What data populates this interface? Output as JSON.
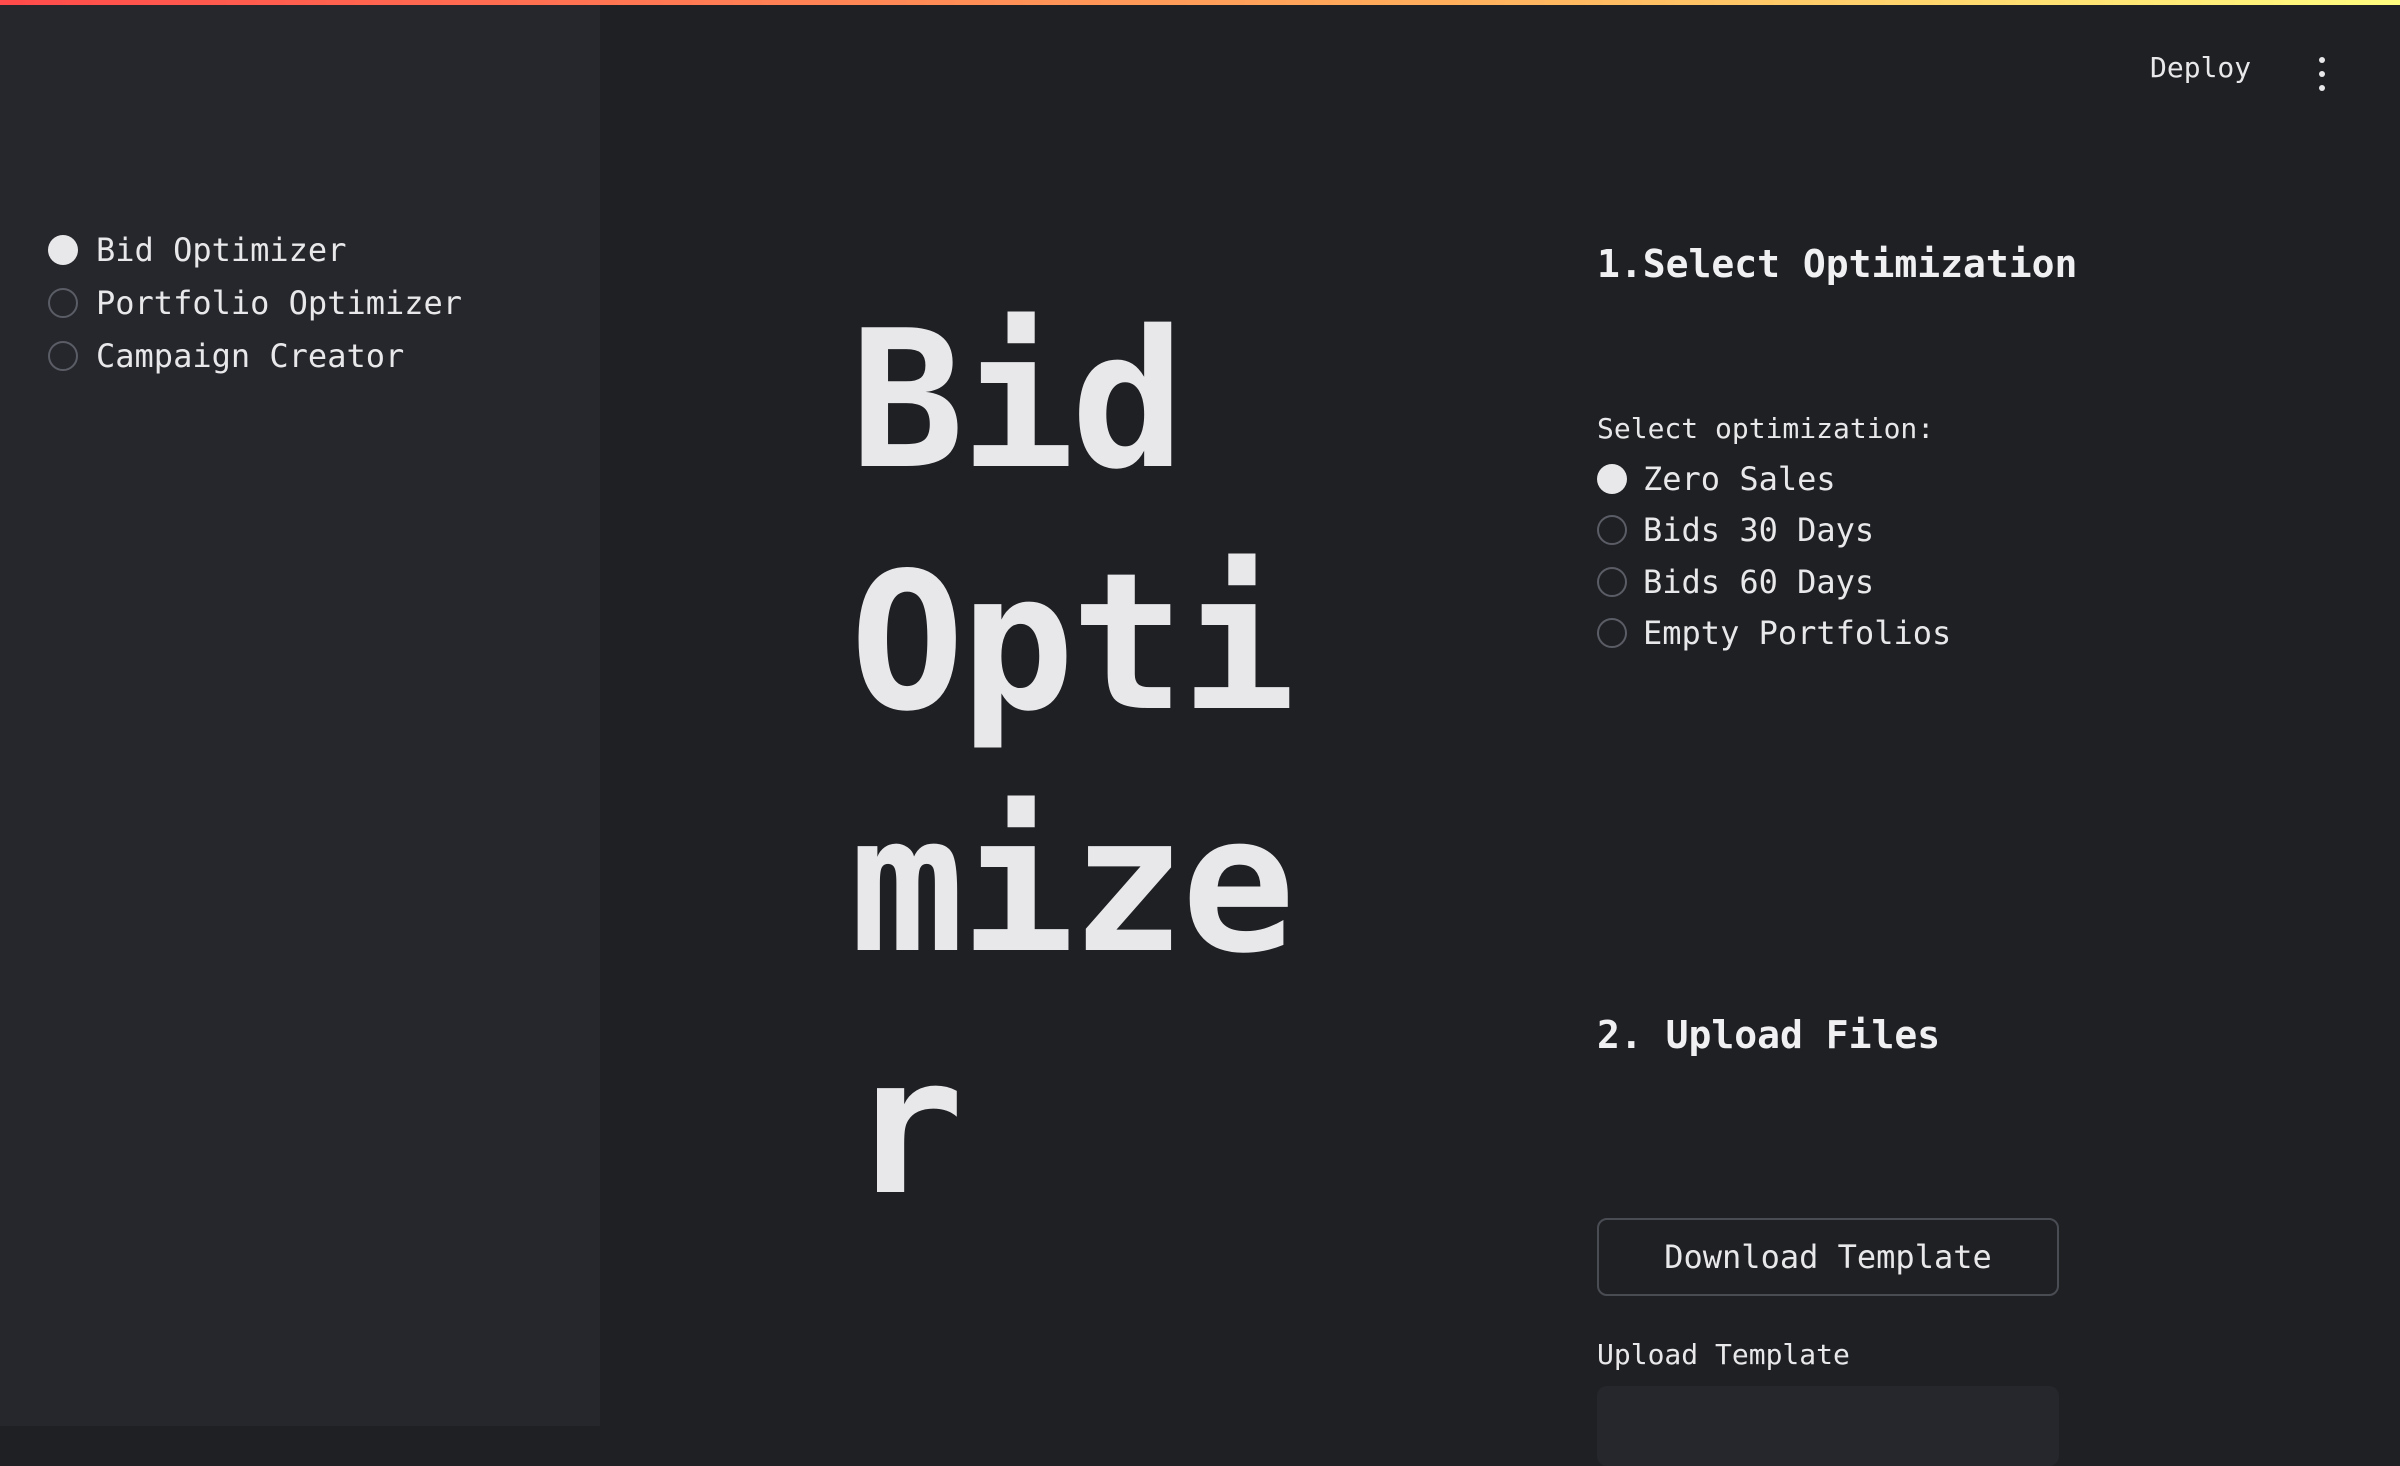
{
  "header": {
    "deploy_label": "Deploy",
    "menu_icon": "more-vertical-icon"
  },
  "sidebar": {
    "items": [
      {
        "label": "Bid Optimizer",
        "selected": true
      },
      {
        "label": "Portfolio Optimizer",
        "selected": false
      },
      {
        "label": "Campaign Creator",
        "selected": false
      }
    ]
  },
  "main": {
    "title": "Bid Optimizer",
    "step1_heading": "1.Select Optimization",
    "select_label": "Select optimization:",
    "options": [
      {
        "label": "Zero Sales",
        "selected": true
      },
      {
        "label": "Bids 30 Days",
        "selected": false
      },
      {
        "label": "Bids 60 Days",
        "selected": false
      },
      {
        "label": "Empty Portfolios",
        "selected": false
      }
    ],
    "step2_heading": "2. Upload Files",
    "download_label": "Download Template",
    "upload_label": "Upload Template"
  },
  "colors": {
    "background": "#1f2024",
    "sidebar": "#26272c",
    "text": "#e8e8ea",
    "accent_gradient_start": "#ff4b4b",
    "accent_gradient_end": "#fffd80"
  }
}
